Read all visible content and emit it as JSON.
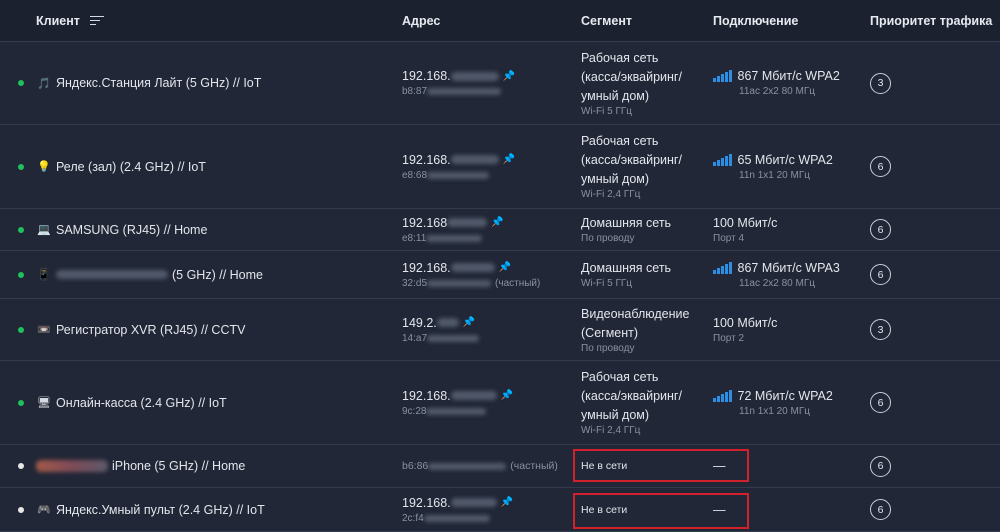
{
  "header": {
    "client": "Клиент",
    "address": "Адрес",
    "segment": "Сегмент",
    "connection": "Подключение",
    "priority": "Приоритет трафика"
  },
  "icons": {
    "sort": "sort-lines-icon",
    "pin": "pin-icon",
    "wifi": "wifi-signal-icon"
  },
  "colors": {
    "online": "#1ec15a",
    "offline": "#e6e6e6",
    "accent": "#2d8ee6",
    "highlight": "#d1222b"
  },
  "rows": [
    {
      "status": "online",
      "icon": "music-icon",
      "icon_glyph": "🎵",
      "name": "Яндекс.Станция Лайт (5 GHz) // IoT",
      "ip_prefix": "192.168.",
      "mac_prefix": "b8:87",
      "private": "",
      "segment": [
        "Рабочая сеть",
        "(касса/эквайринг/",
        "умный дом)"
      ],
      "segment_sub": "Wi-Fi 5 ГГц",
      "conn_main": "867 Мбит/с  WPA2",
      "conn_sub": "11ac 2x2 80 МГц",
      "wifi": true,
      "priority": "3"
    },
    {
      "status": "online",
      "icon": "lightbulb-icon",
      "icon_glyph": "💡",
      "name": "Реле (зал) (2.4 GHz) // IoT",
      "ip_prefix": "192.168.",
      "mac_prefix": "e8:68",
      "private": "",
      "segment": [
        "Рабочая сеть",
        "(касса/эквайринг/",
        "умный дом)"
      ],
      "segment_sub": "Wi-Fi 2,4 ГГц",
      "conn_main": "65 Мбит/с  WPA2",
      "conn_sub": "11n 1x1 20 МГц",
      "wifi": true,
      "priority": "6"
    },
    {
      "status": "online",
      "icon": "laptop-icon",
      "icon_glyph": "💻",
      "name": "SAMSUNG (RJ45) // Home",
      "ip_prefix": "192.168",
      "mac_prefix": "e8:11",
      "private": "",
      "segment": [
        "Домашняя сеть"
      ],
      "segment_sub": "По проводу",
      "conn_main": "100 Мбит/с",
      "conn_sub": "Порт 4",
      "wifi": false,
      "priority": "6"
    },
    {
      "status": "online",
      "icon": "phone-icon",
      "icon_glyph": "📱",
      "name": "(5 GHz) // Home",
      "ip_prefix": "192.168.",
      "mac_prefix": "32:d5",
      "private": "(частный)",
      "segment": [
        "Домашняя сеть"
      ],
      "segment_sub": "Wi-Fi 5 ГГц",
      "conn_main": "867 Мбит/с  WPA3",
      "conn_sub": "11ac 2x2 80 МГц",
      "wifi": true,
      "priority": "6"
    },
    {
      "status": "online",
      "icon": "recorder-icon",
      "icon_glyph": "📼",
      "name": "Регистратор XVR (RJ45) // CCTV",
      "ip_prefix": "149.2.",
      "mac_prefix": "14:a7",
      "private": "",
      "segment": [
        "Видеонаблюдение",
        "(Сегмент)"
      ],
      "segment_sub": "По проводу",
      "conn_main": "100 Мбит/с",
      "conn_sub": "Порт 2",
      "wifi": false,
      "priority": "3"
    },
    {
      "status": "online",
      "icon": "monitor-icon",
      "icon_glyph": "🖥",
      "name": "Онлайн-касса (2.4 GHz) // IoT",
      "ip_prefix": "192.168.",
      "mac_prefix": "9c:28",
      "private": "",
      "segment": [
        "Рабочая сеть",
        "(касса/эквайринг/",
        "умный дом)"
      ],
      "segment_sub": "Wi-Fi 2,4 ГГц",
      "conn_main": "72 Мбит/с  WPA2",
      "conn_sub": "11n 1x1 20 МГц",
      "wifi": true,
      "priority": "6"
    },
    {
      "status": "offline",
      "icon": "",
      "icon_glyph": "",
      "name": "iPhone (5 GHz) // Home",
      "ip_prefix": "",
      "mac_prefix": "b6:86",
      "private": "(частный)",
      "segment": [],
      "segment_sub": "",
      "offline_label": "Не в сети",
      "conn_main": "—",
      "conn_sub": "",
      "wifi": false,
      "priority": "6"
    },
    {
      "status": "offline",
      "icon": "gamepad-icon",
      "icon_glyph": "🎮",
      "name": "Яндекс.Умный пульт (2.4 GHz) // IoT",
      "ip_prefix": "192.168.",
      "mac_prefix": "2c:f4",
      "private": "",
      "segment": [],
      "segment_sub": "",
      "offline_label": "Не в сети",
      "conn_main": "—",
      "conn_sub": "",
      "wifi": false,
      "priority": "6"
    }
  ]
}
